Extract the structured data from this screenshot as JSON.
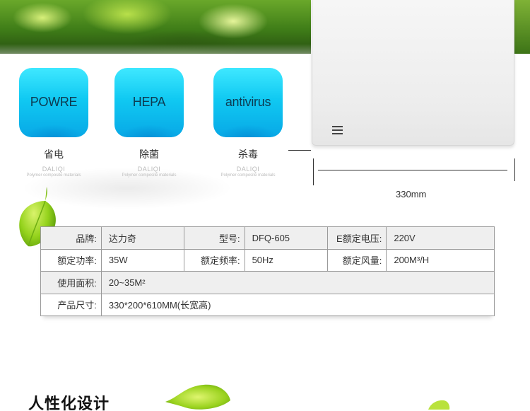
{
  "features": [
    {
      "tile_label": "POWRE",
      "title": "省电",
      "brand": "DALIQI",
      "subtitle": "Polymer composite materials"
    },
    {
      "tile_label": "HEPA",
      "title": "除菌",
      "brand": "DALIQI",
      "subtitle": "Polymer composite materials"
    },
    {
      "tile_label": "antivirus",
      "title": "杀毒",
      "brand": "DALIQI",
      "subtitle": "Polymer composite materials"
    }
  ],
  "product": {
    "width_dimension": "330mm"
  },
  "specs": {
    "brand_label": "品牌:",
    "brand_value": "达力奇",
    "model_label": "型号:",
    "model_value": "DFQ-605",
    "voltage_label": "E额定电压:",
    "voltage_value": "220V",
    "power_label": "额定功率:",
    "power_value": "35W",
    "frequency_label": "额定频率:",
    "frequency_value": "50Hz",
    "airflow_label": "额定风量:",
    "airflow_value": "200M³/H",
    "area_label": "使用面积:",
    "area_value": "20~35M²",
    "size_label": "产品尺寸:",
    "size_value": "330*200*610MM(长宽高)"
  },
  "section": {
    "title": "人性化设计"
  },
  "colors": {
    "tile_top": "#3fe8ff",
    "tile_bottom": "#08a8e6",
    "leaf_green": "#8fd11a",
    "table_row_gray": "#efefef"
  },
  "icons": {
    "panel": "menu-icon",
    "decor": "leaf-icon"
  }
}
